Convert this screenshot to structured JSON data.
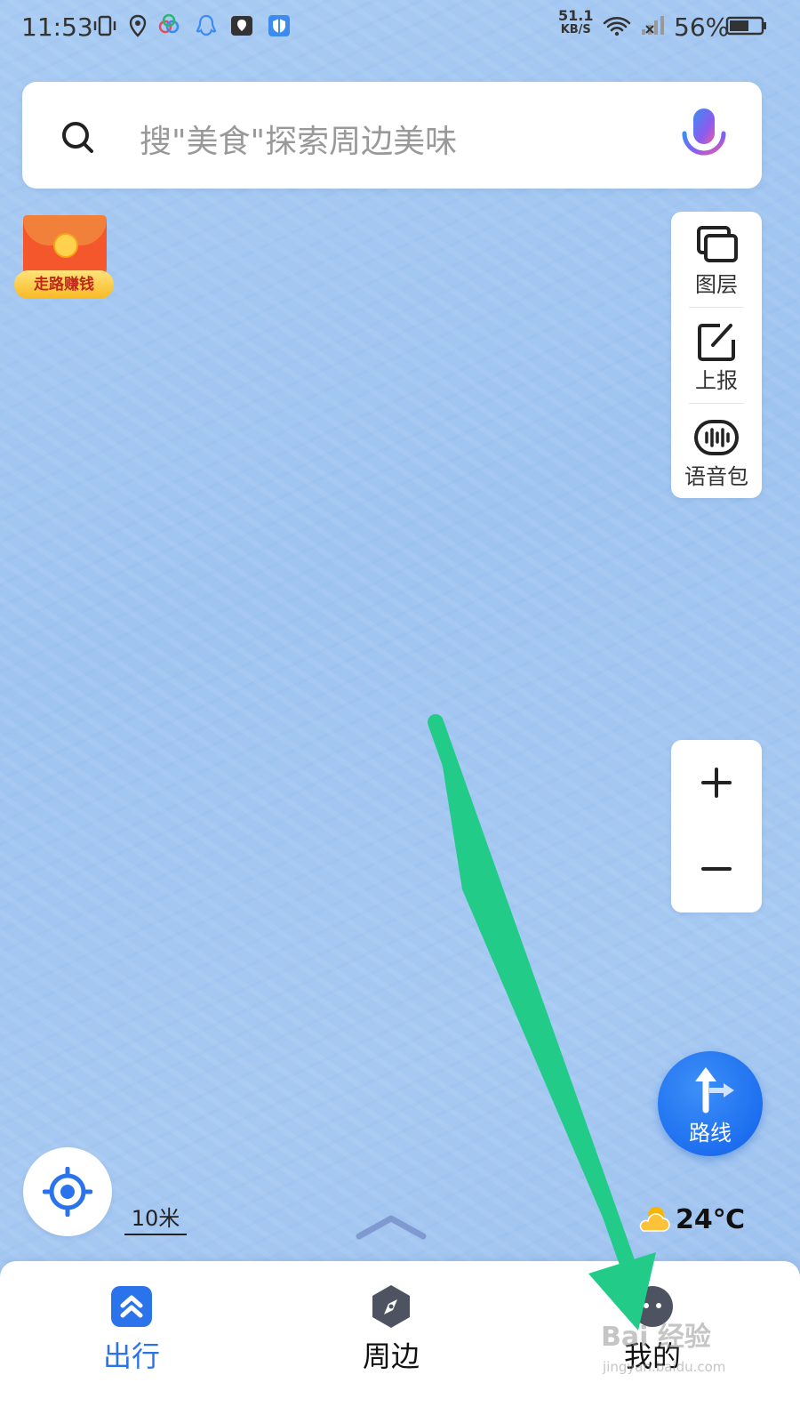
{
  "status_bar": {
    "time": "11:53",
    "net_speed_value": "51.1",
    "net_speed_unit": "KB/S",
    "battery_percent": "56%"
  },
  "search": {
    "placeholder": "搜\"美食\"探索周边美味",
    "icons": [
      "search-icon",
      "microphone-icon"
    ]
  },
  "promo": {
    "label": "走路赚钱"
  },
  "tools": [
    {
      "label": "图层",
      "icon": "layers-icon"
    },
    {
      "label": "上报",
      "icon": "report-edit-icon"
    },
    {
      "label": "语音包",
      "icon": "voice-pack-icon"
    }
  ],
  "zoom": {
    "zoom_in_icon": "plus-icon",
    "zoom_out_icon": "minus-icon"
  },
  "route_button": {
    "label": "路线"
  },
  "scale": {
    "value": "10米"
  },
  "weather": {
    "temperature": "24℃",
    "icon": "partly-cloudy-icon"
  },
  "bottom_nav": [
    {
      "label": "出行",
      "icon": "travel-icon",
      "active": true
    },
    {
      "label": "周边",
      "icon": "compass-icon",
      "active": false
    },
    {
      "label": "我的",
      "icon": "profile-avatar-icon",
      "active": false
    }
  ],
  "watermark": {
    "text": "Bai 经验",
    "sub": "jingyan.baidu.com"
  },
  "colors": {
    "accent": "#2a73ea",
    "map_water": "#a6c9f2",
    "annotation_arrow": "#22cc88"
  }
}
